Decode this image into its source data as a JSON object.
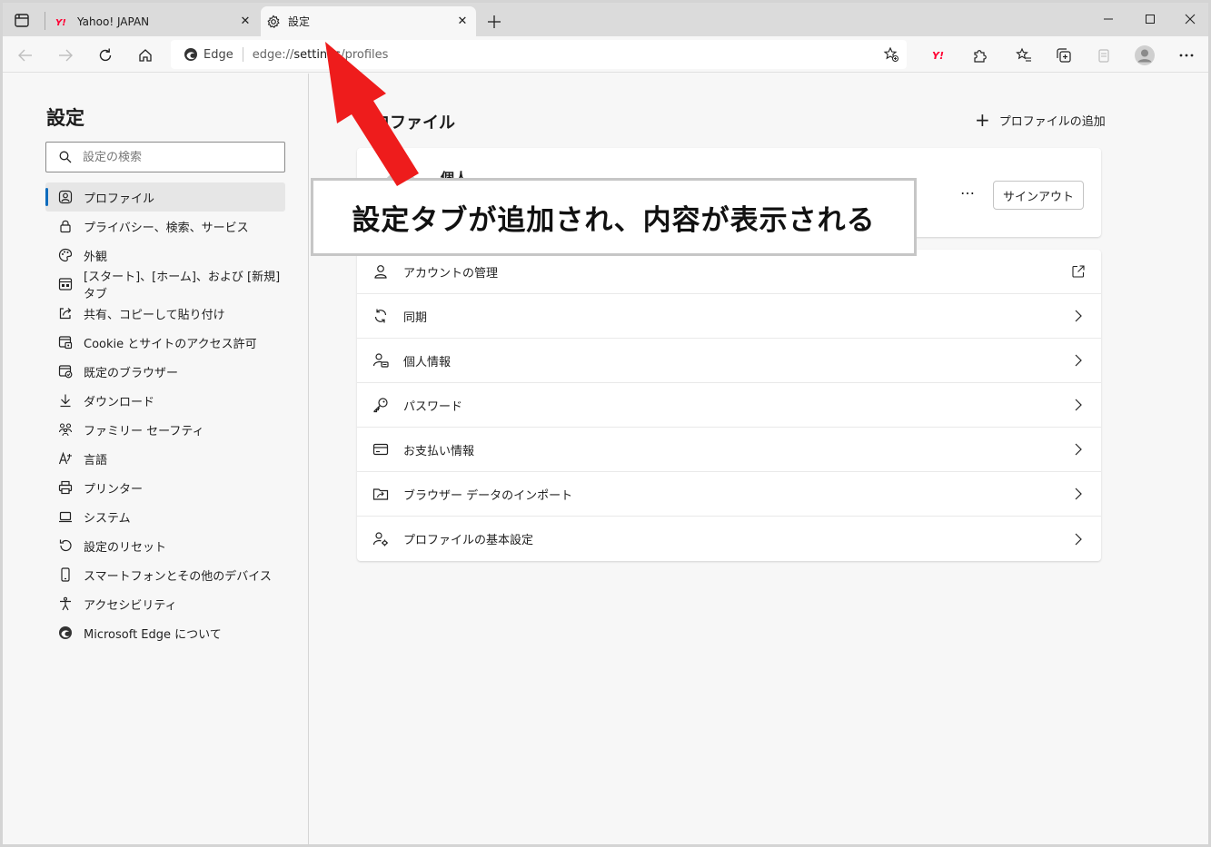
{
  "tabs": [
    {
      "title": "Yahoo! JAPAN",
      "favicon": "yahoo-icon",
      "active": false
    },
    {
      "title": "設定",
      "favicon": "gear-icon",
      "active": true
    }
  ],
  "address_bar": {
    "brand_label": "Edge",
    "url_prefix": "edge://",
    "url_host": "settings",
    "url_path": "/profiles"
  },
  "sidebar": {
    "title": "設定",
    "search_placeholder": "設定の検索",
    "items": [
      {
        "label": "プロファイル",
        "icon": "profile-icon",
        "selected": true
      },
      {
        "label": "プライバシー、検索、サービス",
        "icon": "lock-icon"
      },
      {
        "label": "外観",
        "icon": "palette-icon"
      },
      {
        "label": "[スタート]、[ホーム]、および [新規] タブ",
        "icon": "newtab-icon"
      },
      {
        "label": "共有、コピーして貼り付け",
        "icon": "share-icon"
      },
      {
        "label": "Cookie とサイトのアクセス許可",
        "icon": "site-permissions-icon"
      },
      {
        "label": "既定のブラウザー",
        "icon": "default-browser-icon"
      },
      {
        "label": "ダウンロード",
        "icon": "download-icon"
      },
      {
        "label": "ファミリー セーフティ",
        "icon": "family-icon"
      },
      {
        "label": "言語",
        "icon": "language-icon"
      },
      {
        "label": "プリンター",
        "icon": "printer-icon"
      },
      {
        "label": "システム",
        "icon": "laptop-icon"
      },
      {
        "label": "設定のリセット",
        "icon": "reset-icon"
      },
      {
        "label": "スマートフォンとその他のデバイス",
        "icon": "phone-icon"
      },
      {
        "label": "アクセシビリティ",
        "icon": "accessibility-icon"
      },
      {
        "label": "Microsoft Edge について",
        "icon": "edge-icon"
      }
    ]
  },
  "main": {
    "title": "プロファイル",
    "add_profile_label": "プロファイルの追加",
    "profile_card": {
      "name": "個人",
      "more_label": "…",
      "signout_label": "サインアウト"
    },
    "settings": [
      {
        "label": "アカウントの管理",
        "icon": "person-icon",
        "trailing": "external-link-icon"
      },
      {
        "label": "同期",
        "icon": "sync-icon",
        "trailing": "chevron-right-icon"
      },
      {
        "label": "個人情報",
        "icon": "personal-info-icon",
        "trailing": "chevron-right-icon"
      },
      {
        "label": "パスワード",
        "icon": "key-icon",
        "trailing": "chevron-right-icon"
      },
      {
        "label": "お支払い情報",
        "icon": "card-icon",
        "trailing": "chevron-right-icon"
      },
      {
        "label": "ブラウザー データのインポート",
        "icon": "import-icon",
        "trailing": "chevron-right-icon"
      },
      {
        "label": "プロファイルの基本設定",
        "icon": "profile-settings-icon",
        "trailing": "chevron-right-icon"
      }
    ]
  },
  "annotation": {
    "callout_text": "設定タブが追加され、内容が表示される",
    "arrow_color": "#ee1c1c"
  },
  "colors": {
    "accent": "#0f6cbd",
    "yahoo_red": "#ff0033"
  }
}
